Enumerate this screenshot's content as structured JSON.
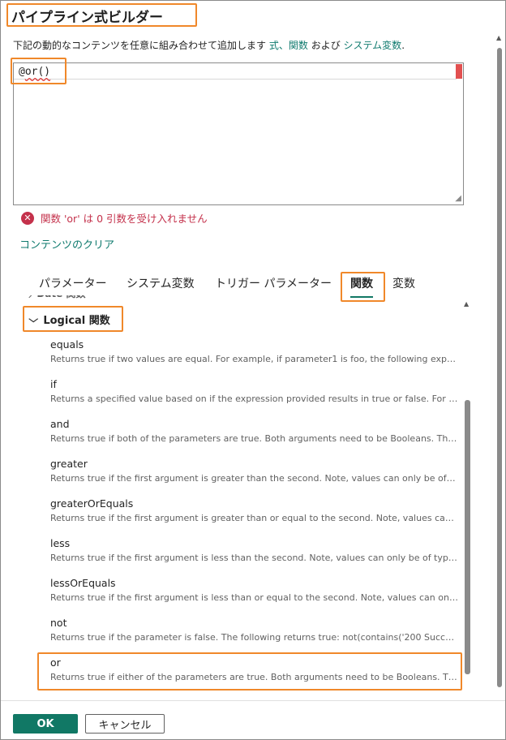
{
  "dialog": {
    "title": "パイプライン式ビルダー",
    "description": "下記の動的なコンテンツを任意に組み合わせて追加します",
    "link_expression": "式、",
    "link_functions": "関数",
    "link_and": "および",
    "link_sysvars": "システム変数",
    "period": "."
  },
  "editor": {
    "code_prefix": "@",
    "code_fn": "or()"
  },
  "error": {
    "icon": "error-circle-icon",
    "message": "関数 'or' は 0 引数を受け入れません"
  },
  "clear_content": "コンテンツのクリア",
  "tabs": [
    {
      "label": "パラメーター"
    },
    {
      "label": "システム変数"
    },
    {
      "label": "トリガー パラメーター"
    },
    {
      "label": "関数",
      "active": true
    },
    {
      "label": "変数"
    }
  ],
  "list": {
    "previous_section": "Date 関数",
    "section_title": "Logical 関数",
    "items": [
      {
        "name": "equals",
        "summary": "Returns true if two values are equal. For example, if parameter1 is foo, the following expressi..."
      },
      {
        "name": "if",
        "summary": "Returns a specified value based on if the expression provided results in true or false. For exa..."
      },
      {
        "name": "and",
        "summary": "Returns true if both of the parameters are true. Both arguments need to be Booleans. The foll..."
      },
      {
        "name": "greater",
        "summary": "Returns true if the first argument is greater than the second. Note, values can only be of type..."
      },
      {
        "name": "greaterOrEquals",
        "summary": "Returns true if the first argument is greater than or equal to the second. Note, values can onl..."
      },
      {
        "name": "less",
        "summary": "Returns true if the first argument is less than the second. Note, values can only be of type int..."
      },
      {
        "name": "lessOrEquals",
        "summary": "Returns true if the first argument is less than or equal to the second. Note, values can only be..."
      },
      {
        "name": "not",
        "summary": "Returns true if the parameter is false. The following returns true: not(contains('200 Success','F..."
      },
      {
        "name": "or",
        "summary": "Returns true if either of the parameters are true. Both arguments need to be Booleans. The fo..."
      }
    ]
  },
  "buttons": {
    "ok": "OK",
    "cancel": "キャンセル"
  },
  "colors": {
    "accent": "#117865",
    "link": "#0f7a6e",
    "error": "#c4314b",
    "highlight": "#f0882a"
  }
}
